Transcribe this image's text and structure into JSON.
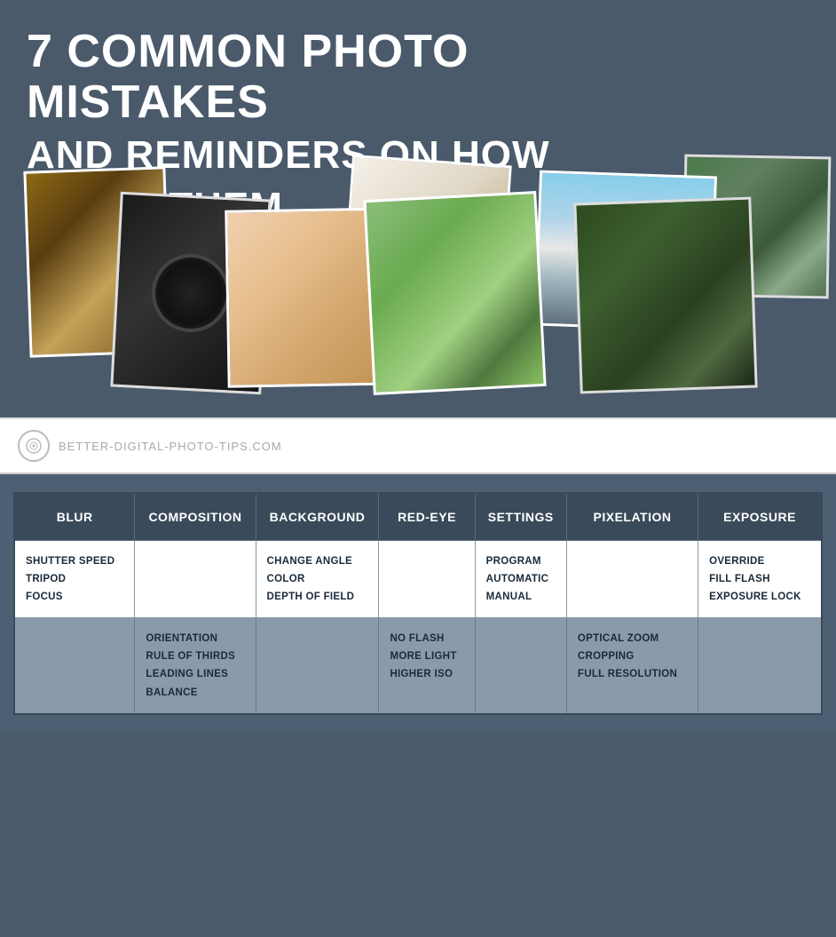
{
  "header": {
    "title_line1": "7 COMMON PHOTO MISTAKES",
    "title_line2": "AND REMINDERS ON HOW",
    "title_line3": "TO FIX THEM"
  },
  "website": {
    "url": "BETTER-DIGITAL-PHOTO-TIPS.COM"
  },
  "table": {
    "headers": [
      "BLUR",
      "COMPOSITION",
      "BACKGROUND",
      "RED-EYE",
      "SETTINGS",
      "PIXELATION",
      "EXPOSURE"
    ],
    "rows": [
      {
        "blur": [
          "SHUTTER SPEED",
          "TRIPOD",
          "FOCUS"
        ],
        "composition": [],
        "background": [
          "CHANGE ANGLE",
          "COLOR",
          "DEPTH OF FIELD"
        ],
        "red_eye": [],
        "settings": [
          "PROGRAM",
          "AUTOMATIC",
          "MANUAL"
        ],
        "pixelation": [],
        "exposure": [
          "OVERRIDE",
          "FILL FLASH",
          "EXPOSURE LOCK"
        ]
      },
      {
        "blur": [],
        "composition": [
          "ORIENTATION",
          "RULE OF THIRDS",
          "LEADING LINES",
          "BALANCE"
        ],
        "background": [],
        "red_eye": [
          "NO FLASH",
          "MORE LIGHT",
          "HIGHER ISO"
        ],
        "settings": [],
        "pixelation": [
          "OPTICAL ZOOM",
          "CROPPING",
          "FULL RESOLUTION"
        ],
        "exposure": []
      }
    ]
  },
  "icons": {
    "camera_lens": "⊙"
  }
}
